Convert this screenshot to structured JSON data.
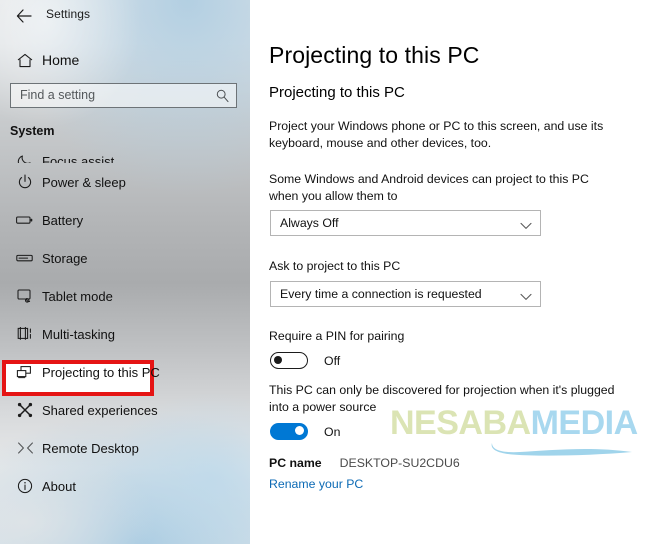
{
  "window": {
    "back_icon": "back-arrow-icon",
    "title": "Settings"
  },
  "sidebar": {
    "home": {
      "label": "Home",
      "icon": "home-icon"
    },
    "search": {
      "placeholder": "Find a setting",
      "value": "",
      "icon": "search-icon"
    },
    "group_header": "System",
    "items": [
      {
        "label": "Focus assist",
        "icon": "moon-icon",
        "selected": false,
        "clipped": true
      },
      {
        "label": "Power & sleep",
        "icon": "power-icon",
        "selected": false
      },
      {
        "label": "Battery",
        "icon": "battery-icon",
        "selected": false
      },
      {
        "label": "Storage",
        "icon": "storage-icon",
        "selected": false
      },
      {
        "label": "Tablet mode",
        "icon": "tablet-icon",
        "selected": false
      },
      {
        "label": "Multi-tasking",
        "icon": "multitasking-icon",
        "selected": false
      },
      {
        "label": "Projecting to this PC",
        "icon": "projecting-icon",
        "selected": true
      },
      {
        "label": "Shared experiences",
        "icon": "shared-experiences-icon",
        "selected": false
      },
      {
        "label": "Remote Desktop",
        "icon": "remote-desktop-icon",
        "selected": false
      },
      {
        "label": "About",
        "icon": "info-icon",
        "selected": false
      }
    ],
    "highlight_color": "#e51414"
  },
  "main": {
    "page_title": "Projecting to this PC",
    "section_heading": "Projecting to this PC",
    "intro_text": "Project your Windows phone or PC to this screen, and use its keyboard, mouse and other devices, too.",
    "allow_label": "Some Windows and Android devices can project to this PC when you allow them to",
    "allow_dropdown": {
      "value": "Always Off",
      "chevron": "chevron-down-icon"
    },
    "ask_label": "Ask to project to this PC",
    "ask_dropdown": {
      "value": "Every time a connection is requested",
      "chevron": "chevron-down-icon"
    },
    "pin_label": "Require a PIN for pairing",
    "pin_toggle": {
      "state": "Off",
      "on": false
    },
    "discover_label": "This PC can only be discovered for projection when it's plugged into a power source",
    "power_toggle": {
      "state": "On",
      "on": true,
      "accent": "#0078d4"
    },
    "pc_name_label": "PC name",
    "pc_name_value": "DESKTOP-SU2CDU6",
    "rename_link": "Rename your PC"
  },
  "watermark": {
    "part1": "NESABA",
    "part2": "MEDIA",
    "color1": "#dbe4b4",
    "color2": "#a8d8ef"
  }
}
